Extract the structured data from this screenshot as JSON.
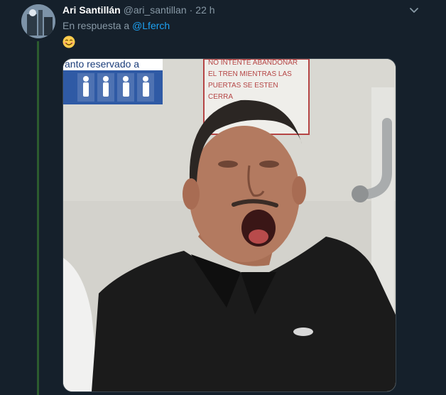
{
  "tweet": {
    "author_name": "Ari Santillán",
    "author_handle": "@ari_santillan",
    "separator": "·",
    "time": "22 h",
    "reply_prefix": "En respuesta a",
    "reply_mention": "@Lferch",
    "emoji": "smiling-face-with-smiling-eyes"
  },
  "media": {
    "sign_left_text": "anto reservado a",
    "sign_right_lines": [
      "NO INTENTE ABANDONAR",
      "EL TREN MIENTRAS LAS",
      "PUERTAS SE ESTEN",
      "CERRA"
    ]
  },
  "colors": {
    "background": "#15202b",
    "thread_line": "#2c5c2f",
    "muted_text": "#8899a6",
    "link": "#1da1f2"
  }
}
